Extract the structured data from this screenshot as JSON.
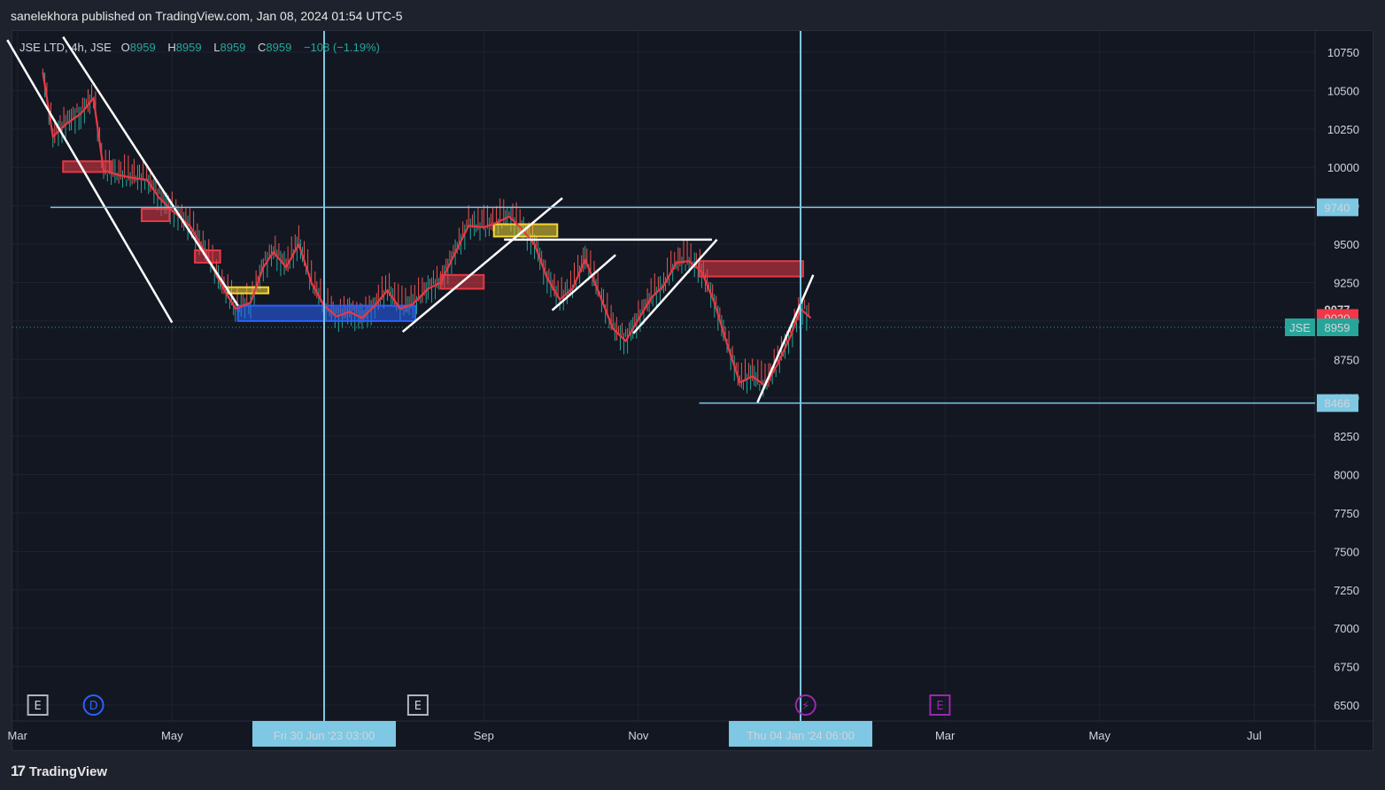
{
  "header": {
    "published_text": "sanelekhora published on TradingView.com, Jan 08, 2024 01:54 UTC-5"
  },
  "legend": {
    "symbol_line": "JSE LTD, 4h, JSE",
    "open_label": "O",
    "open": "8959",
    "high_label": "H",
    "high": "8959",
    "low_label": "L",
    "low": "8959",
    "close_label": "C",
    "close": "8959",
    "change": "−108 (−1.19%)"
  },
  "footer": {
    "brand": "TradingView",
    "logo": "17"
  },
  "colors": {
    "background": "#131722",
    "grid": "#1f2330",
    "up": "#26a69a",
    "down": "#ef5350",
    "ma_line": "#e53945",
    "hline": "#7ec8e3",
    "trendline": "#ffffff",
    "red_zone": "#e53945",
    "yellow_zone": "#f2d633",
    "blue_zone": "#2962ff",
    "price_badge": "#26a69a",
    "ma_badge": "#f23645"
  },
  "chart_data": {
    "type": "line",
    "title": "JSE LTD, 4h, JSE",
    "ylim": [
      6400,
      10850
    ],
    "x_range": [
      "2023-02-27",
      "2024-07-25"
    ],
    "y_ticks": [
      6500,
      6750,
      7000,
      7250,
      7500,
      7750,
      8000,
      8250,
      8500,
      8750,
      9000,
      9250,
      9500,
      9750,
      10000,
      10250,
      10500,
      10750
    ],
    "x_ticks": [
      {
        "label": "Mar",
        "date": "2023-03-01"
      },
      {
        "label": "May",
        "date": "2023-05-01"
      },
      {
        "label": "Sep",
        "date": "2023-09-01"
      },
      {
        "label": "Nov",
        "date": "2023-11-01"
      },
      {
        "label": "Mar",
        "date": "2024-03-01"
      },
      {
        "label": "May",
        "date": "2024-05-01"
      },
      {
        "label": "Jul",
        "date": "2024-07-01"
      }
    ],
    "series": [
      {
        "name": "",
        "points": [
          [
            "2023-03-11",
            10620
          ],
          [
            "2023-03-15",
            10200
          ],
          [
            "2023-03-20",
            10280
          ],
          [
            "2023-03-26",
            10350
          ],
          [
            "2023-03-31",
            10450
          ],
          [
            "2023-04-04",
            9980
          ],
          [
            "2023-04-10",
            9950
          ],
          [
            "2023-04-16",
            9930
          ],
          [
            "2023-04-21",
            9920
          ],
          [
            "2023-04-26",
            9800
          ],
          [
            "2023-05-01",
            9720
          ],
          [
            "2023-05-08",
            9620
          ],
          [
            "2023-05-14",
            9450
          ],
          [
            "2023-05-20",
            9250
          ],
          [
            "2023-05-26",
            9080
          ],
          [
            "2023-06-01",
            9120
          ],
          [
            "2023-06-06",
            9350
          ],
          [
            "2023-06-10",
            9450
          ],
          [
            "2023-06-15",
            9350
          ],
          [
            "2023-06-20",
            9500
          ],
          [
            "2023-06-25",
            9250
          ],
          [
            "2023-06-30",
            9100
          ],
          [
            "2023-07-05",
            9030
          ],
          [
            "2023-07-10",
            9060
          ],
          [
            "2023-07-15",
            9020
          ],
          [
            "2023-07-20",
            9100
          ],
          [
            "2023-07-25",
            9200
          ],
          [
            "2023-07-30",
            9080
          ],
          [
            "2023-08-04",
            9110
          ],
          [
            "2023-08-10",
            9210
          ],
          [
            "2023-08-15",
            9250
          ],
          [
            "2023-08-20",
            9420
          ],
          [
            "2023-08-26",
            9620
          ],
          [
            "2023-09-01",
            9610
          ],
          [
            "2023-09-06",
            9640
          ],
          [
            "2023-09-11",
            9680
          ],
          [
            "2023-09-16",
            9600
          ],
          [
            "2023-09-21",
            9500
          ],
          [
            "2023-09-26",
            9280
          ],
          [
            "2023-10-01",
            9140
          ],
          [
            "2023-10-06",
            9210
          ],
          [
            "2023-10-11",
            9400
          ],
          [
            "2023-10-16",
            9200
          ],
          [
            "2023-10-22",
            8950
          ],
          [
            "2023-10-27",
            8870
          ],
          [
            "2023-11-01",
            9010
          ],
          [
            "2023-11-06",
            9150
          ],
          [
            "2023-11-11",
            9230
          ],
          [
            "2023-11-16",
            9380
          ],
          [
            "2023-11-21",
            9390
          ],
          [
            "2023-11-26",
            9320
          ],
          [
            "2023-12-01",
            9120
          ],
          [
            "2023-12-06",
            8850
          ],
          [
            "2023-12-11",
            8600
          ],
          [
            "2023-12-16",
            8640
          ],
          [
            "2023-12-21",
            8580
          ],
          [
            "2023-12-26",
            8720
          ],
          [
            "2023-12-31",
            8900
          ],
          [
            "2024-01-04",
            9080
          ],
          [
            "2024-01-08",
            9020
          ]
        ]
      }
    ],
    "horizontal_lines": [
      {
        "value": 9740,
        "label": "9740",
        "from": "2023-03-14"
      },
      {
        "value": 8466,
        "label": "8466",
        "from": "2023-11-25"
      }
    ],
    "vertical_lines": [
      {
        "date": "2023-06-30",
        "label": "Fri 30 Jun '23   03:00"
      },
      {
        "date": "2024-01-04",
        "label": "Thu 04 Jan '24   06:00"
      }
    ],
    "price_badges": [
      {
        "value": 9077,
        "label": "9077"
      },
      {
        "value": 9020,
        "label": "9020"
      },
      {
        "value": 8959,
        "label": "8959",
        "symbol": "JSE"
      }
    ],
    "zones": [
      {
        "color": "red",
        "from": "2023-03-19",
        "to": "2023-04-07",
        "y1": 10040,
        "y2": 9970
      },
      {
        "color": "red",
        "from": "2023-04-19",
        "to": "2023-04-30",
        "y1": 9730,
        "y2": 9650
      },
      {
        "color": "red",
        "from": "2023-05-10",
        "to": "2023-05-20",
        "y1": 9460,
        "y2": 9380
      },
      {
        "color": "yellow",
        "from": "2023-05-23",
        "to": "2023-06-08",
        "y1": 9220,
        "y2": 9180
      },
      {
        "color": "blue",
        "from": "2023-05-27",
        "to": "2023-08-05",
        "y1": 9100,
        "y2": 9000
      },
      {
        "color": "red",
        "from": "2023-08-15",
        "to": "2023-09-01",
        "y1": 9300,
        "y2": 9210
      },
      {
        "color": "yellow",
        "from": "2023-09-05",
        "to": "2023-09-30",
        "y1": 9630,
        "y2": 9550
      },
      {
        "color": "red",
        "from": "2023-11-25",
        "to": "2024-01-05",
        "y1": 9390,
        "y2": 9290
      }
    ],
    "trendlines": [
      {
        "from": [
          "2023-02-25",
          10830
        ],
        "to": [
          "2023-05-01",
          8990
        ]
      },
      {
        "from": [
          "2023-03-19",
          10850
        ],
        "to": [
          "2023-05-27",
          9100
        ]
      },
      {
        "from": [
          "2023-07-31",
          8930
        ],
        "to": [
          "2023-10-02",
          9800
        ]
      },
      {
        "from": [
          "2023-09-09",
          9530
        ],
        "to": [
          "2023-11-30",
          9530
        ]
      },
      {
        "from": [
          "2023-09-28",
          9070
        ],
        "to": [
          "2023-10-23",
          9430
        ]
      },
      {
        "from": [
          "2023-10-30",
          8920
        ],
        "to": [
          "2023-12-02",
          9530
        ]
      },
      {
        "from": [
          "2023-12-18",
          8470
        ],
        "to": [
          "2024-01-09",
          9300
        ]
      }
    ],
    "event_markers": [
      {
        "symbol": "E",
        "date": "2023-03-09",
        "type": "earnings"
      },
      {
        "symbol": "D",
        "date": "2023-03-31",
        "type": "dividend"
      },
      {
        "symbol": "E",
        "date": "2023-08-06",
        "type": "earnings"
      },
      {
        "symbol": "⚡",
        "date": "2024-01-06",
        "type": "split"
      },
      {
        "symbol": "E",
        "date": "2024-02-28",
        "type": "earnings-upcoming"
      }
    ]
  }
}
